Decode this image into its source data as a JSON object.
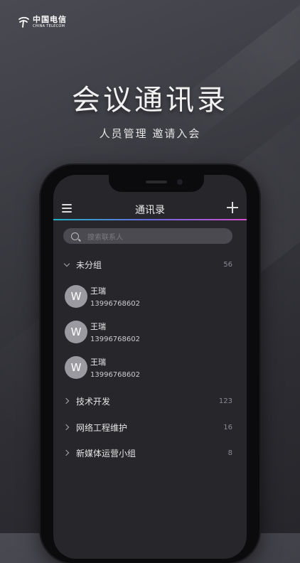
{
  "brand": {
    "name_cn": "中国电信",
    "name_en": "CHINA TELECOM"
  },
  "hero": {
    "title": "会议通讯录",
    "subtitle": "人员管理 邀请入会"
  },
  "app": {
    "nav_title": "通讯录",
    "search_placeholder": "搜索联系人",
    "groups": [
      {
        "name": "未分组",
        "count": "56",
        "expanded": true,
        "contacts": [
          {
            "initial": "W",
            "name": "王瑞",
            "phone": "13996768602"
          },
          {
            "initial": "W",
            "name": "王瑞",
            "phone": "13996768602"
          },
          {
            "initial": "W",
            "name": "王瑞",
            "phone": "13996768602"
          }
        ]
      },
      {
        "name": "技术开发",
        "count": "123",
        "expanded": false
      },
      {
        "name": "网络工程维护",
        "count": "16",
        "expanded": false
      },
      {
        "name": "新媒体运营小组",
        "count": "8",
        "expanded": false
      }
    ]
  },
  "colors": {
    "accent_start": "#1fb4c8",
    "accent_end": "#d44fd0",
    "avatar": "#9a9aa0"
  }
}
